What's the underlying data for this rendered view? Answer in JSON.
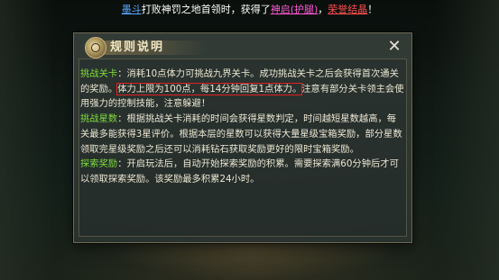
{
  "marquee": {
    "player": "墨斗",
    "text1": "打败神罚之地首领时，获得了",
    "item1": "神启(护腿)",
    "sep": "，",
    "item2": "荣誉结晶",
    "end": "！"
  },
  "dialog": {
    "title": "规则说明",
    "close_label": "✕",
    "sections": [
      {
        "label": "挑战关卡",
        "colon": "：",
        "text_before": "消耗10点体力可挑战九界关卡。成功挑战关卡之后会获得首次通关的奖励。",
        "highlight": "体力上限为100点，每14分钟回复1点体力。",
        "text_after": "注意有部分关卡领主会使用强力的控制技能，注意躲避！"
      },
      {
        "label": "挑战星数",
        "colon": "：",
        "text": "根据挑战关卡消耗的时间会获得星数判定，时间越短星数越高，每关最多能获得3星评价。根据本层的星数可以获得大量星级宝箱奖励，部分星数领取完星级奖励之后还可以消耗钻石获取奖励更好的限时宝箱奖励。"
      },
      {
        "label": "探索奖励",
        "colon": "：",
        "text": "开启玩法后，自动开始探索奖励的积累。需要探索满60分钟后才可以领取探索奖励。该奖励最多积累24小时。"
      }
    ]
  }
}
